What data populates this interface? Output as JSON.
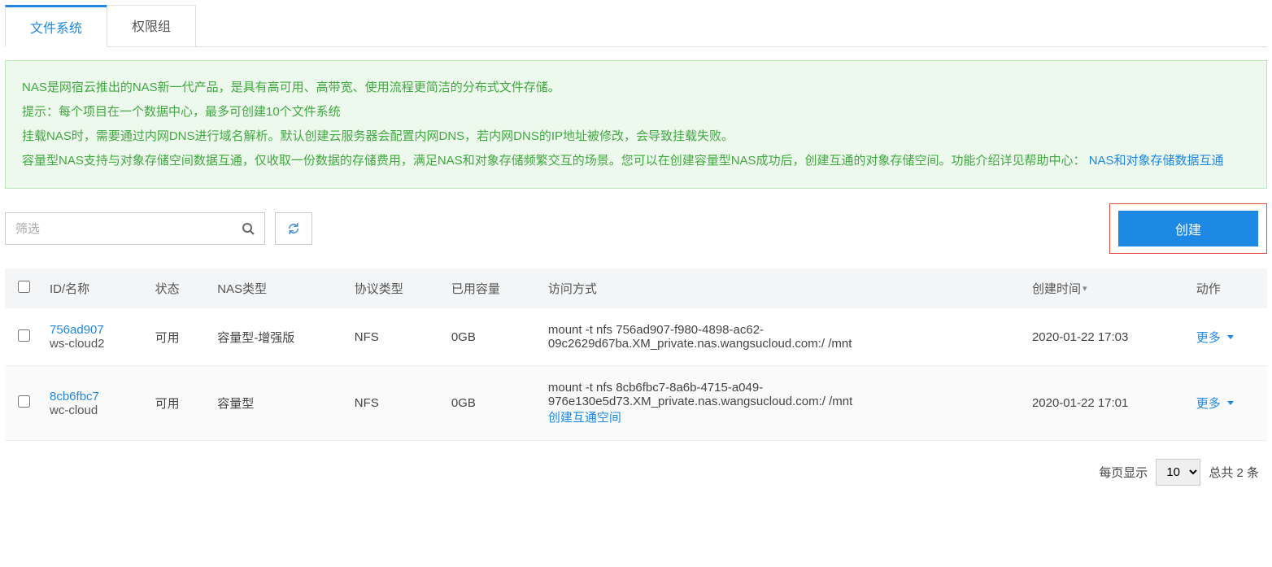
{
  "tabs": {
    "filesystem": "文件系统",
    "permission": "权限组"
  },
  "info": {
    "line1": "NAS是网宿云推出的NAS新一代产品，是具有高可用、高带宽、使用流程更简洁的分布式文件存储。",
    "line2": "提示：每个项目在一个数据中心，最多可创建10个文件系统",
    "line3": "挂载NAS时，需要通过内网DNS进行域名解析。默认创建云服务器会配置内网DNS，若内网DNS的IP地址被修改，会导致挂载失败。",
    "line4a": "容量型NAS支持与对象存储空间数据互通，仅收取一份数据的存储费用，满足NAS和对象存储频繁交互的场景。您可以在创建容量型NAS成功后，创建互通的对象存储空间。功能介绍详见帮助中心： ",
    "line4link": "NAS和对象存储数据互通"
  },
  "filter_placeholder": "筛选",
  "create_label": "创建",
  "columns": {
    "id": "ID/名称",
    "status": "状态",
    "type": "NAS类型",
    "protocol": "协议类型",
    "used": "已用容量",
    "access": "访问方式",
    "created": "创建时间",
    "action": "动作"
  },
  "rows": [
    {
      "id": "756ad907",
      "name": "ws-cloud2",
      "status": "可用",
      "type": "容量型-增强版",
      "protocol": "NFS",
      "used": "0GB",
      "access": "mount -t nfs 756ad907-f980-4898-ac62-09c2629d67ba.XM_private.nas.wangsucloud.com:/ /mnt",
      "access_link": "",
      "created": "2020-01-22 17:03",
      "more": "更多"
    },
    {
      "id": "8cb6fbc7",
      "name": "wc-cloud",
      "status": "可用",
      "type": "容量型",
      "protocol": "NFS",
      "used": "0GB",
      "access": "mount -t nfs 8cb6fbc7-8a6b-4715-a049-976e130e5d73.XM_private.nas.wangsucloud.com:/ /mnt",
      "access_link": "创建互通空间",
      "created": "2020-01-22 17:01",
      "more": "更多"
    }
  ],
  "pager": {
    "per_page_label": "每页显示",
    "per_page_value": "10",
    "total_prefix": "总共 ",
    "total_count": "2",
    "total_suffix": " 条"
  }
}
